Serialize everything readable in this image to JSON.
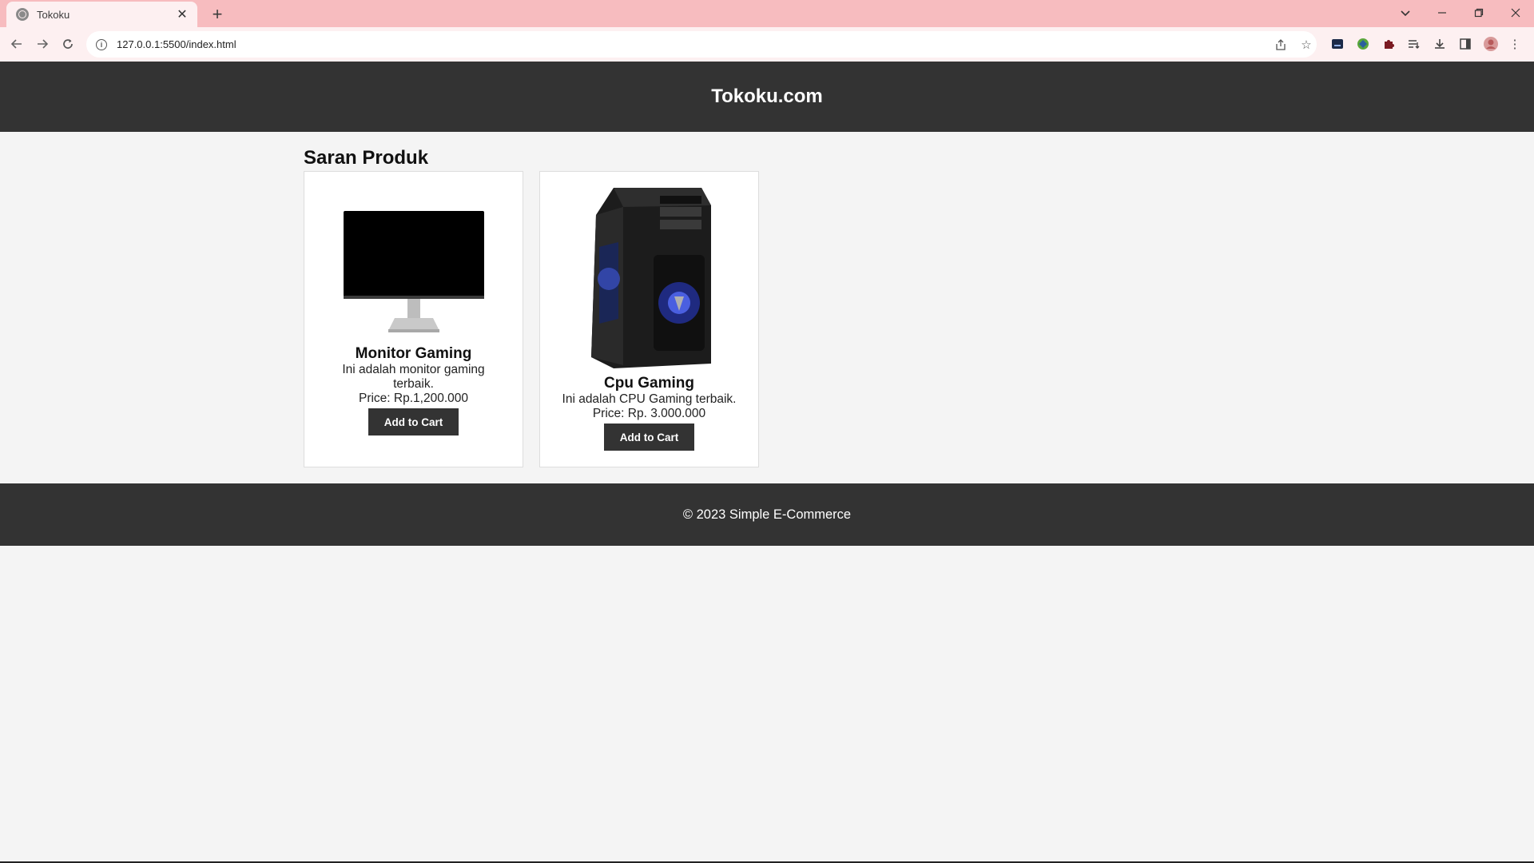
{
  "browser": {
    "tab_title": "Tokoku",
    "url": "127.0.0.1:5500/index.html",
    "tabstrip_color": "#f7bcbf"
  },
  "header": {
    "site_title": "Tokoku.com"
  },
  "main": {
    "section_title": "Saran Produk",
    "products": [
      {
        "name": "Monitor Gaming",
        "description": "Ini adalah monitor gaming terbaik.",
        "price": "Price: Rp.1,200.000",
        "button_label": "Add to Cart",
        "image_icon": "monitor-image"
      },
      {
        "name": "Cpu Gaming",
        "description": "Ini adalah CPU Gaming terbaik.",
        "price": "Price: Rp. 3.000.000",
        "button_label": "Add to Cart",
        "image_icon": "pc-case-image"
      }
    ]
  },
  "footer": {
    "text": "© 2023 Simple E-Commerce"
  },
  "colors": {
    "header_bg": "#333333",
    "page_bg": "#f4f4f4",
    "button_bg": "#333333"
  }
}
